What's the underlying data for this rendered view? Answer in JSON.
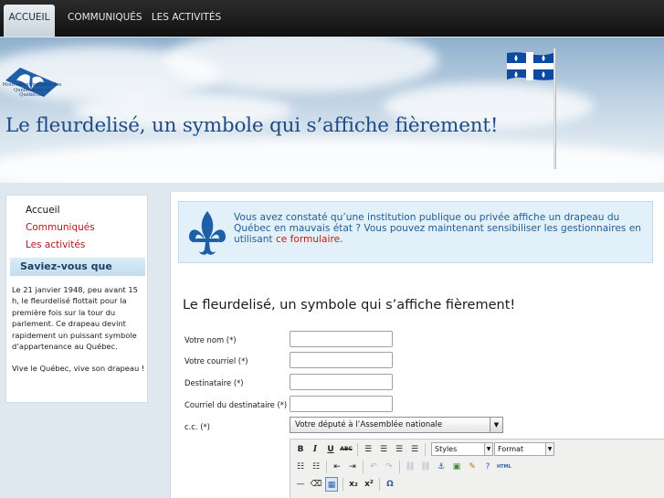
{
  "nav": {
    "tabs": [
      {
        "label": "ACCUEIL"
      },
      {
        "label": "COMMUNIQUÉS"
      },
      {
        "label": "LES ACTIVITÉS"
      }
    ]
  },
  "banner": {
    "title": "Le fleurdelisé, un symbole qui s’affiche fièrement!",
    "logo_text": "Mouvement national des Québécoises et Québécois"
  },
  "sidebar": {
    "items": [
      {
        "label": "Accueil"
      },
      {
        "label": "Communiqués"
      },
      {
        "label": "Les activités"
      }
    ],
    "saviez_title": "Saviez-vous que",
    "paragraph1": "Le 21 janvier 1948, peu avant 15 h, le fleurdelisé flottait pour la première fois sur la tour du parlement. Ce drapeau devint rapidement un puissant symbole d’appartenance au Québec.",
    "paragraph2": "Vive le Québec, vive son drapeau !"
  },
  "alert": {
    "text": "Vous avez constaté qu’une institution publique ou privée affiche un drapeau du Québec en mauvais état ? Vous pouvez maintenant sensibiliser les gestionnaires en utilisant ",
    "link": "ce formulaire",
    "end": "."
  },
  "form": {
    "title": "Le fleurdelisé, un symbole qui s’affiche fièrement!",
    "fields": [
      {
        "label": "Votre nom (*)",
        "value": ""
      },
      {
        "label": "Votre courriel (*)",
        "value": ""
      },
      {
        "label": "Destinataire (*)",
        "value": ""
      },
      {
        "label": "Courriel du destinataire (*)",
        "value": ""
      }
    ],
    "cc_label": "c.c. (*)",
    "cc_value": "Votre député à l’Assemblée nationale",
    "editor": {
      "styles": "Styles",
      "format": "Format",
      "bold": "B",
      "italic": "I",
      "underline": "U",
      "strike": "ABC",
      "html": "HTML",
      "subscript": "x₂",
      "superscript": "x²",
      "omega": "Ω"
    }
  },
  "colors": {
    "nav_bg": "#1a1a1a",
    "title_blue": "#1e4a86",
    "link_red": "#b5161b",
    "alert_bg": "#e2f0f9",
    "alert_text": "#225d94",
    "flag_blue": "#0d49a3"
  },
  "icons": [
    "fleur-de-lis-icon",
    "quebec-flag",
    "bold-icon",
    "italic-icon",
    "underline-icon",
    "strikethrough-icon",
    "align-left-icon",
    "align-center-icon",
    "align-right-icon",
    "justify-icon",
    "bullet-list-icon",
    "numbered-list-icon",
    "outdent-icon",
    "indent-icon",
    "undo-icon",
    "redo-icon",
    "link-icon",
    "unlink-icon",
    "anchor-icon",
    "image-icon",
    "cleanup-icon",
    "help-icon",
    "horizontal-rule-icon",
    "remove-format-icon",
    "table-icon",
    "subscript-icon",
    "superscript-icon",
    "special-char-icon"
  ]
}
